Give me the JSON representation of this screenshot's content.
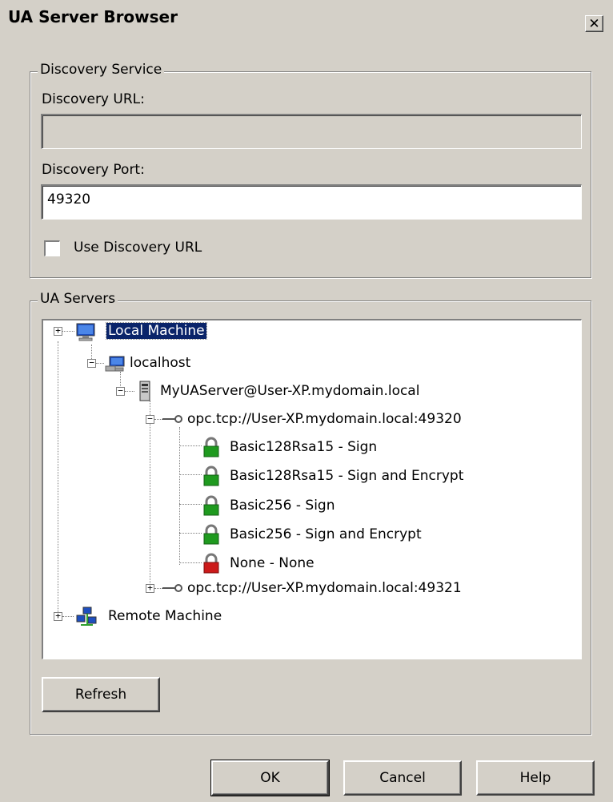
{
  "window": {
    "title": "UA Server Browser",
    "close_glyph": "✕"
  },
  "discovery": {
    "legend": "Discovery Service",
    "url_label": "Discovery URL:",
    "url_value": "",
    "port_label": "Discovery Port:",
    "port_value": "49320",
    "use_url_label": "Use Discovery URL",
    "use_url_checked": false
  },
  "servers": {
    "legend": "UA Servers",
    "tree": {
      "local_machine": "Local Machine",
      "localhost": "localhost",
      "server": "MyUAServer@User-XP.mydomain.local",
      "endpoint_1": "opc.tcp://User-XP.mydomain.local:49320",
      "policies": [
        {
          "label": "Basic128Rsa15 - Sign",
          "lock_color": "#1f9a1f"
        },
        {
          "label": "Basic128Rsa15 - Sign and Encrypt",
          "lock_color": "#1f9a1f"
        },
        {
          "label": "Basic256 - Sign",
          "lock_color": "#1f9a1f"
        },
        {
          "label": "Basic256 - Sign and Encrypt",
          "lock_color": "#1f9a1f"
        },
        {
          "label": "None - None",
          "lock_color": "#cc1a1a"
        }
      ],
      "endpoint_2": "opc.tcp://User-XP.mydomain.local:49321",
      "remote_machine": "Remote Machine"
    },
    "refresh_label": "Refresh"
  },
  "buttons": {
    "ok": "OK",
    "cancel": "Cancel",
    "help": "Help"
  },
  "colors": {
    "selection": "#0a246a",
    "dialog_bg": "#d4d0c8"
  }
}
